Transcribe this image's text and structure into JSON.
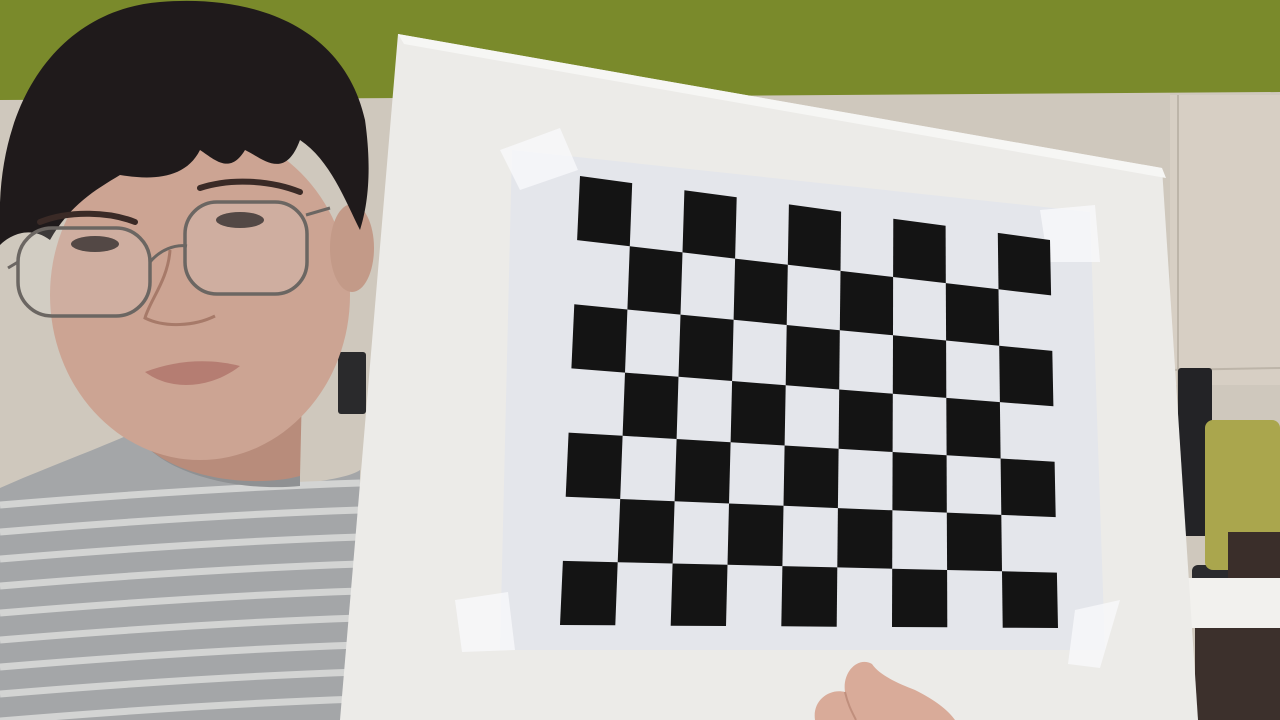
{
  "scene": {
    "subject": "person-holding-checkerboard",
    "checkerboard": {
      "columns": 9,
      "rows": 7
    },
    "colors": {
      "ceiling": "#7a8a2b",
      "wall": "#cfc8bd",
      "board": "#ecebe8",
      "paper": "#e4e6eb",
      "square_dark": "#141414",
      "shirt": "#a4a6a8",
      "shirt_stripe": "#d3d4d3",
      "hair": "#1f1a1b",
      "skin": "#cca493",
      "chair": "#aaa64d"
    }
  }
}
